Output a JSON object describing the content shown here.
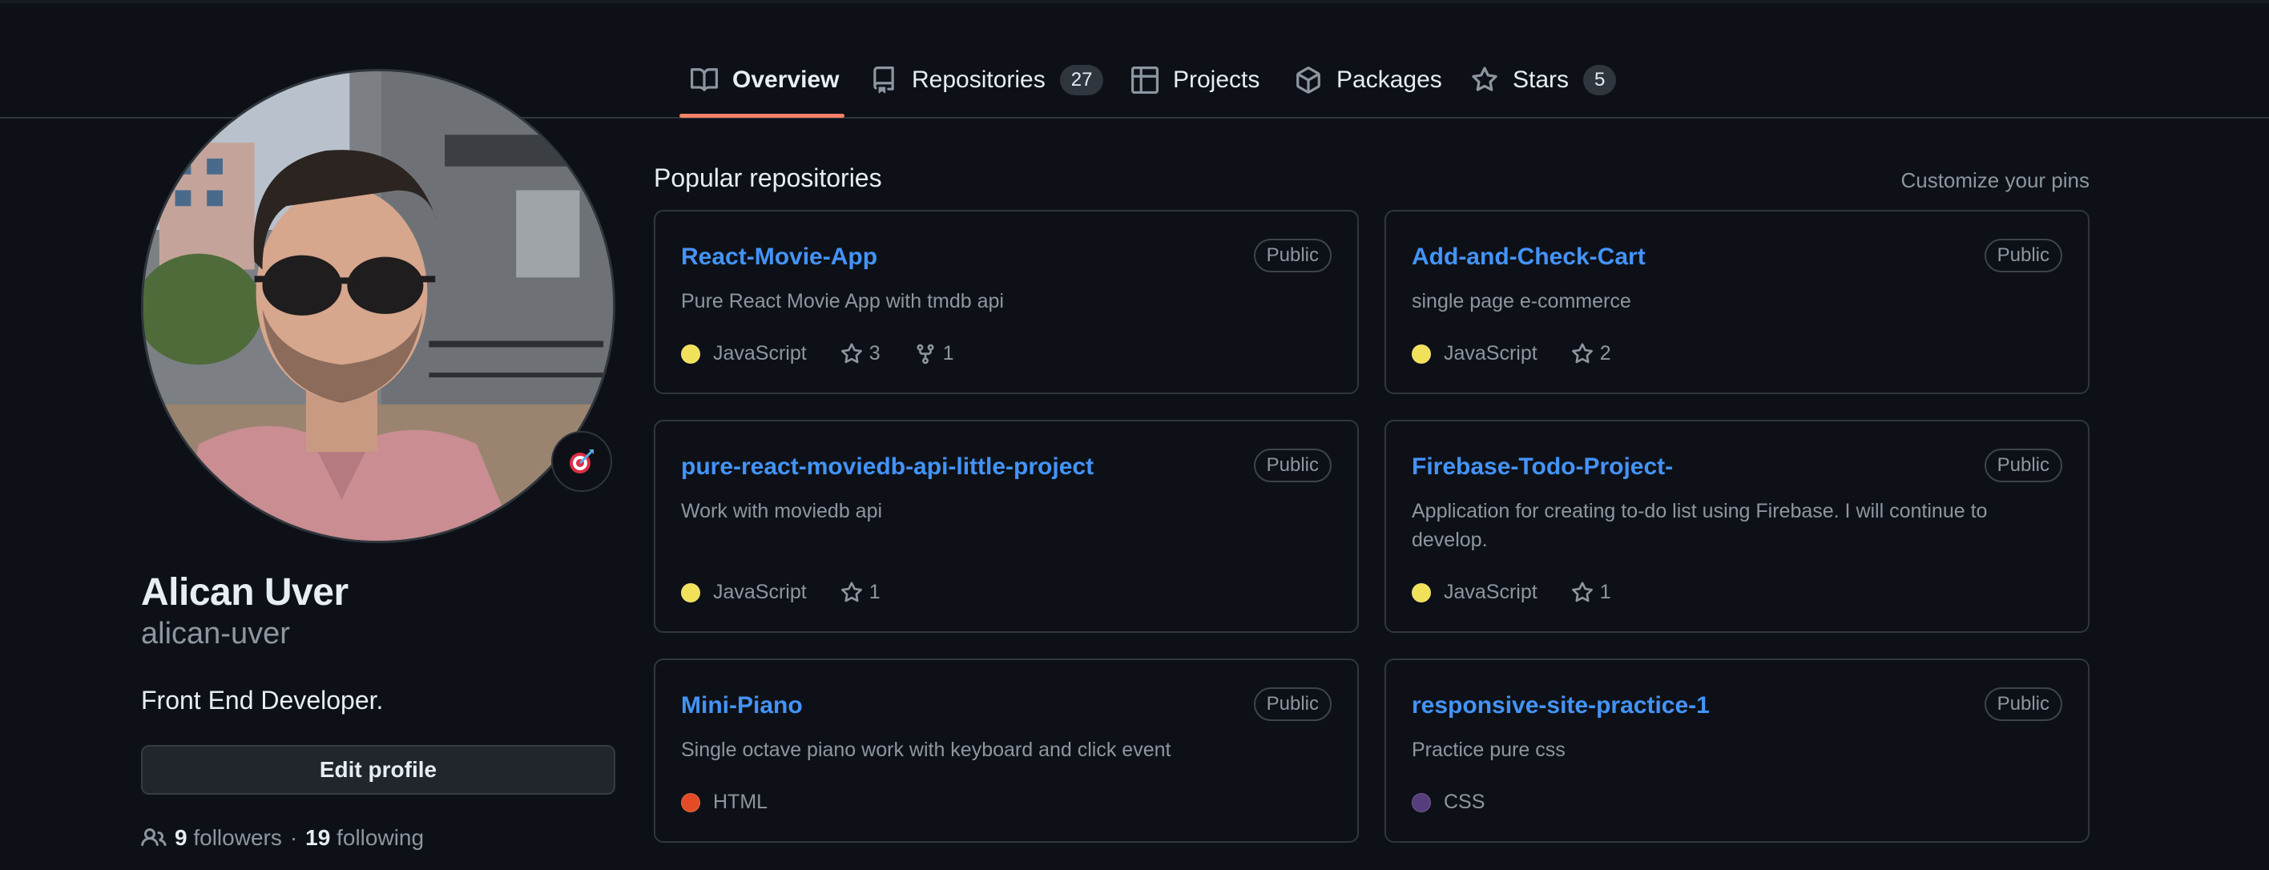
{
  "tabs": [
    {
      "label": "Overview",
      "icon": "book-icon",
      "selected": true
    },
    {
      "label": "Repositories",
      "icon": "repo-icon",
      "count": "27"
    },
    {
      "label": "Projects",
      "icon": "table-icon"
    },
    {
      "label": "Packages",
      "icon": "package-icon"
    },
    {
      "label": "Stars",
      "icon": "star-icon",
      "count": "5"
    }
  ],
  "profile": {
    "name": "Alican Uver",
    "login": "alican-uver",
    "bio": "Front End Developer.",
    "edit_label": "Edit profile",
    "followers_count": "9",
    "followers_label": "followers",
    "separator": "·",
    "following_count": "19",
    "following_label": "following",
    "status_emoji": "dart-icon"
  },
  "popular": {
    "title": "Popular repositories",
    "customize_label": "Customize your pins",
    "repos": [
      {
        "name": "React-Movie-App",
        "visibility": "Public",
        "description": "Pure React Movie App with tmdb api",
        "language": "JavaScript",
        "language_color": "#f1e05a",
        "stars": "3",
        "forks": "1"
      },
      {
        "name": "Add-and-Check-Cart",
        "visibility": "Public",
        "description": "single page e-commerce",
        "language": "JavaScript",
        "language_color": "#f1e05a",
        "stars": "2"
      },
      {
        "name": "pure-react-moviedb-api-little-project",
        "visibility": "Public",
        "description": "Work with moviedb api",
        "language": "JavaScript",
        "language_color": "#f1e05a",
        "stars": "1"
      },
      {
        "name": "Firebase-Todo-Project-",
        "visibility": "Public",
        "description": "Application for creating to-do list using Firebase. I will continue to develop.",
        "language": "JavaScript",
        "language_color": "#f1e05a",
        "stars": "1"
      },
      {
        "name": "Mini-Piano",
        "visibility": "Public",
        "description": "Single octave piano work with keyboard and click event",
        "language": "HTML",
        "language_color": "#e34c26"
      },
      {
        "name": "responsive-site-practice-1",
        "visibility": "Public",
        "description": "Practice pure css",
        "language": "CSS",
        "language_color": "#563d7c"
      }
    ]
  },
  "colors": {
    "background": "#0d1117",
    "link": "#4493f8",
    "muted": "#8d96a0",
    "border": "#30363d",
    "tab_underline": "#f78166"
  }
}
